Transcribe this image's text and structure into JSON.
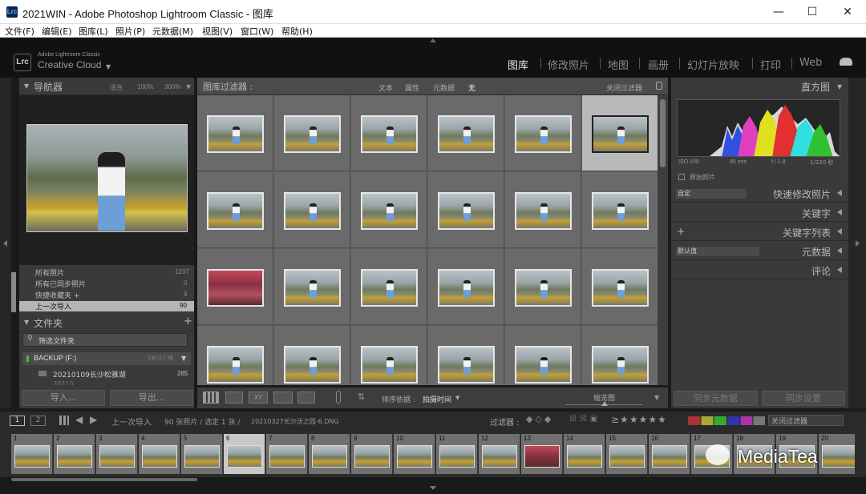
{
  "window": {
    "title": "2021WIN - Adobe Photoshop Lightroom Classic - 图库",
    "app_icon": "Lrc",
    "minimize": "—",
    "maximize": "☐",
    "close": "✕"
  },
  "menu": [
    "文件(F)",
    "编辑(E)",
    "图库(L)",
    "照片(P)",
    "元数据(M)",
    "视图(V)",
    "窗口(W)",
    "帮助(H)"
  ],
  "identity": {
    "logo": "Lrc",
    "line1": "Adobe Lightroom Classic",
    "line2": "Creative Cloud"
  },
  "modules": [
    "图库",
    "修改照片",
    "地图",
    "画册",
    "幻灯片放映",
    "打印",
    "Web"
  ],
  "navigator": {
    "title": "导航器",
    "zoom_fit": "适合",
    "zoom_100": "100%",
    "zoom_300": "300%"
  },
  "catalog": [
    {
      "label": "所有照片",
      "count": "1237"
    },
    {
      "label": "所有已同步照片",
      "count": "0"
    },
    {
      "label": "快捷收藏夹 +",
      "count": "9"
    },
    {
      "label": "上一次导入",
      "count": "90"
    }
  ],
  "folders": {
    "title": "文件夹",
    "plus": "+",
    "filter_placeholder": "筛选文件夹",
    "volume": "BACKUP (F:)",
    "volume_size": "0.8 / 2.7 TB",
    "items": [
      {
        "label": "20210109长沙松雅湖",
        "count": "285"
      },
      {
        "label": "20210...",
        "count": "..."
      }
    ]
  },
  "buttons": {
    "import": "导入...",
    "export": "导出..."
  },
  "filterbar": {
    "title": "图库过滤器 :",
    "text": "文本",
    "attribute": "属性",
    "metadata": "元数据",
    "none": "无",
    "off": "关闭过滤器"
  },
  "toolbar": {
    "sort_label": "排序依据 :",
    "sort_value": "拍摄时间",
    "thumb_label": "缩览图"
  },
  "right": {
    "histogram": "直方图",
    "iso": "ISO 100",
    "focal": "85 mm",
    "fstop": "f / 1.8",
    "shutter": "1/320 秒",
    "original": "原始照片",
    "quick_preset": "自定",
    "quick_develop": "快速修改照片",
    "keywording": "关键字",
    "keyword_list": "关键字列表",
    "meta_preset": "默认值",
    "metadata": "元数据",
    "comments": "评论",
    "sync_meta": "同步元数据",
    "sync_settings": "同步设置"
  },
  "filmbar": {
    "page1": "1",
    "page2": "2",
    "source": "上一次导入",
    "count_text": "90 张照片 / 选定 1 张 /",
    "file": "20210327长沙沃之园-6.DNG",
    "filter": "过滤器 :",
    "filter_off": "关闭过滤器"
  },
  "filmstrip": {
    "numbers": [
      "1",
      "2",
      "3",
      "4",
      "5",
      "6",
      "7",
      "8",
      "9",
      "10",
      "11",
      "12",
      "13",
      "14",
      "15",
      "16",
      "17",
      "18",
      "19",
      "20"
    ]
  },
  "watermark": "MediaTea",
  "colors": {
    "accent": "#e6e6e6",
    "panel": "#3a3a3a",
    "grid": "#5c5c5c",
    "selected": "#b9b9b9"
  }
}
